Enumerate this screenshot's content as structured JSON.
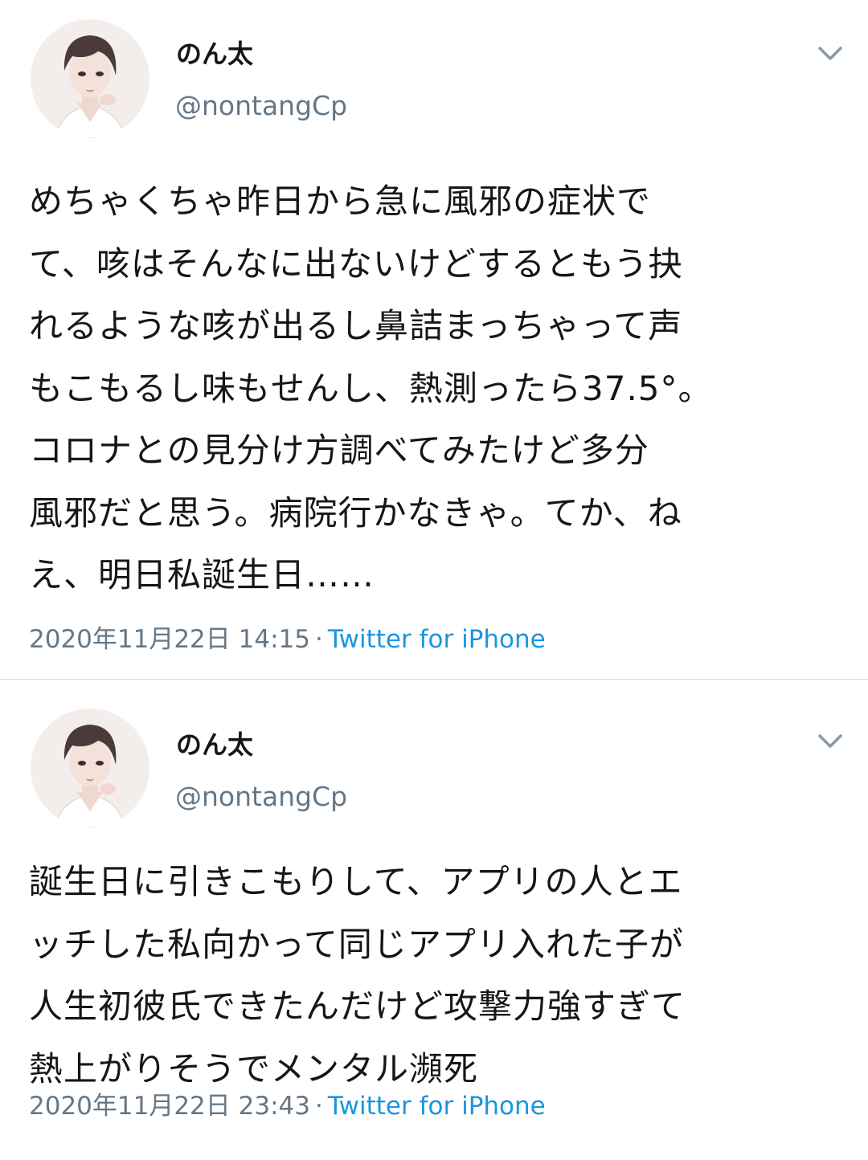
{
  "tweets": [
    {
      "author": {
        "display_name": "のん太",
        "handle": "@nontangCp"
      },
      "text": "めちゃくちゃ昨日から急に風邪の症状で\nて、咳はそんなに出ないけどするともう抉\nれるような咳が出るし鼻詰まっちゃって声\nもこもるし味もせんし、熱測ったら37.5°。\nコロナとの見分け方調べてみたけど多分\n風邪だと思う。病院行かなきゃ。てか、ね\nえ、明日私誕生日……",
      "timestamp": "2020年11月22日 14:15",
      "separator": "·",
      "source": "Twitter for iPhone"
    },
    {
      "author": {
        "display_name": "のん太",
        "handle": "@nontangCp"
      },
      "text": "誕生日に引きこもりして、アプリの人とエ\nッチした私向かって同じアプリ入れた子が\n人生初彼氏できたんだけど攻撃力強すぎて\n熱上がりそうでメンタル瀕死",
      "timestamp": "2020年11月22日 23:43",
      "separator": "·",
      "source": "Twitter for iPhone"
    }
  ],
  "colors": {
    "text": "#14171a",
    "secondary": "#657786",
    "link": "#1b95e0",
    "divider": "#dcdcdc"
  },
  "icons": [
    "avatar",
    "chevron-down-icon"
  ]
}
